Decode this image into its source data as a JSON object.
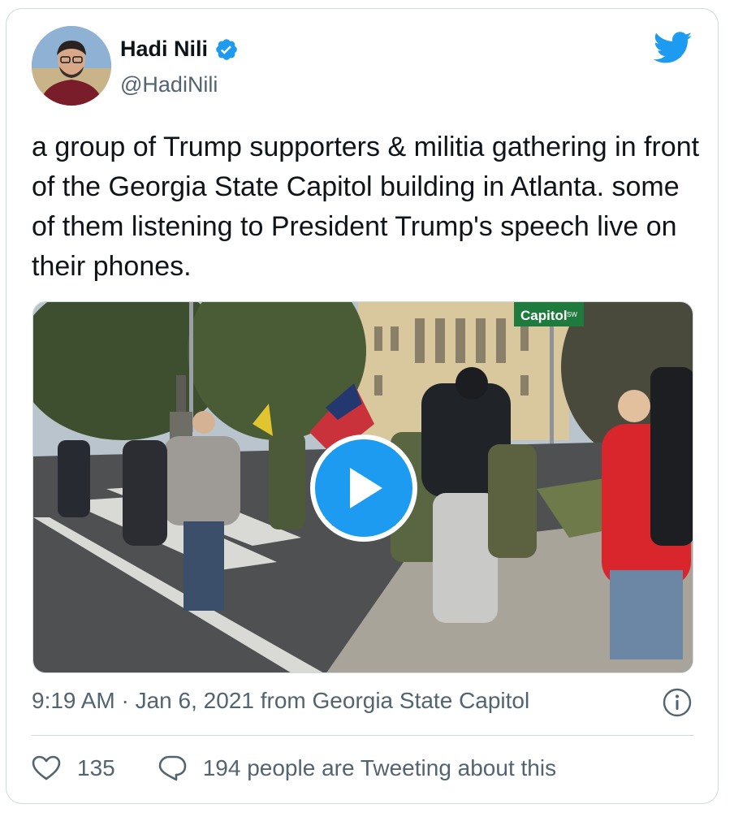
{
  "author": {
    "name": "Hadi Nili",
    "handle": "@HadiNili",
    "verified": true
  },
  "tweet": {
    "text": "a group of Trump supporters & militia gathering in front of the Georgia State Capitol building in Atlanta. some of them listening to President Trump's speech live on their phones."
  },
  "media": {
    "type": "video",
    "street_sign": "Capitol",
    "street_sign_suffix": "SW"
  },
  "meta": {
    "timestamp": "9:19 AM · Jan 6, 2021 from Georgia State Capitol"
  },
  "actions": {
    "like_count": "135",
    "reply_text": "194 people are Tweeting about this"
  },
  "colors": {
    "accent": "#1d9bf0",
    "text": "#0f1419",
    "secondary": "#536471",
    "border": "#cfd9de"
  }
}
